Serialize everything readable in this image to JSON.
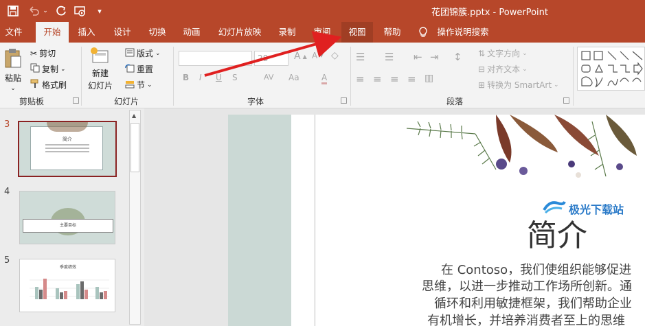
{
  "titlebar": {
    "document_title": "花团锦簇.pptx  -  PowerPoint",
    "save_icon": "save-icon",
    "undo_icon": "undo-icon",
    "redo_icon": "redo-icon",
    "present_icon": "present-from-start-icon",
    "customize_icon": "customize-qat-icon",
    "colors": {
      "titlebar": "#b7472a",
      "ribbon": "#f3f3f3"
    }
  },
  "tabs": {
    "file": "文件",
    "home": "开始",
    "insert": "插入",
    "design": "设计",
    "transitions": "切换",
    "animations": "动画",
    "slideshow": "幻灯片放映",
    "record": "录制",
    "review": "审阅",
    "view": "视图",
    "help": "帮助",
    "tellme": "操作说明搜索",
    "active": "开始",
    "hovered": "视图"
  },
  "ribbon": {
    "clipboard": {
      "paste": "粘贴",
      "cut": "剪切",
      "copy": "复制",
      "format_painter": "格式刷",
      "label": "剪贴板"
    },
    "slides": {
      "new_slide_line1": "新建",
      "new_slide_line2": "幻灯片",
      "layout": "版式",
      "reset": "重置",
      "section": "节",
      "label": "幻灯片"
    },
    "font": {
      "size_value": "28",
      "bold": "B",
      "italic": "I",
      "underline": "U",
      "strike": "S",
      "spacing": "AV",
      "case": "Aa",
      "grow": "A",
      "shrink": "A",
      "color": "A",
      "label": "字体"
    },
    "paragraph": {
      "text_direction": "文字方向",
      "align_text": "对齐文本",
      "smartart": "转换为 SmartArt",
      "label": "段落"
    }
  },
  "thumbnails": [
    {
      "number": "3",
      "title": "简介",
      "selected": true
    },
    {
      "number": "4",
      "title": "主要目标",
      "selected": false
    },
    {
      "number": "5",
      "title": "季度绩效",
      "selected": false
    }
  ],
  "slide": {
    "title": "简介",
    "lines": [
      "在 Contoso，我们使组织能够促进",
      "思维，以进一步推动工作场所创新。通",
      "循环和利用敏捷框架，我们帮助企业",
      "有机增长，并培养消费者至上的思维"
    ]
  },
  "watermark": {
    "text": "极光下载站"
  }
}
